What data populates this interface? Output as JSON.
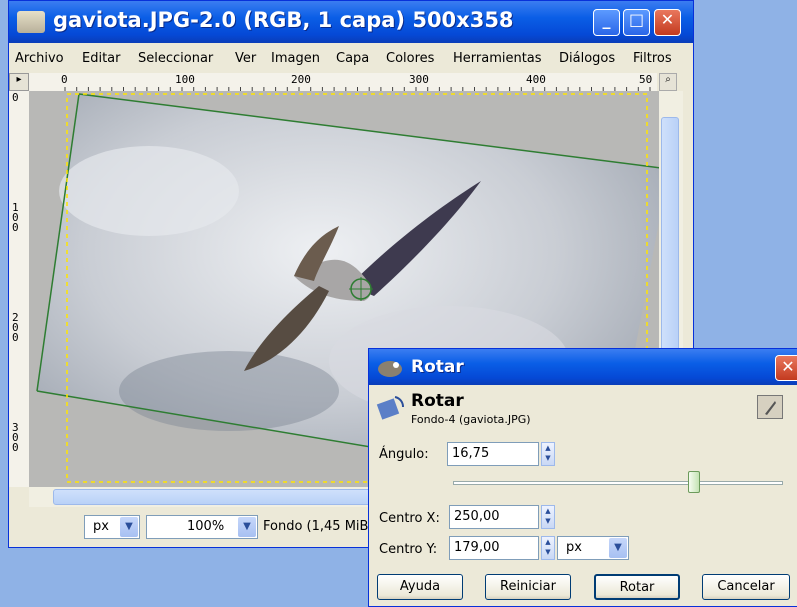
{
  "window": {
    "title": "gaviota.JPG-2.0 (RGB, 1 capa) 500x358",
    "minimize_label": "_",
    "maximize_label": "□",
    "close_label": "✕"
  },
  "menubar": {
    "items": [
      "Archivo",
      "Editar",
      "Seleccionar",
      "Ver",
      "Imagen",
      "Capa",
      "Colores",
      "Herramientas",
      "Diálogos",
      "Filtros"
    ]
  },
  "ruler": {
    "h_labels": [
      "0",
      "100",
      "200",
      "300",
      "400",
      "50"
    ],
    "v_labels": [
      "0",
      "100",
      "200",
      "300"
    ]
  },
  "statusbar": {
    "unit": "px",
    "zoom": "100%",
    "layer_info": "Fondo (1,45 MiB"
  },
  "dialog": {
    "title": "Rotar",
    "header": "Rotar",
    "subheader": "Fondo-4 (gaviota.JPG)",
    "angle_label": "Ángulo:",
    "angle_value": "16,75",
    "angle_slider_fraction": 0.73,
    "center_x_label": "Centro X:",
    "center_x_value": "250,00",
    "center_y_label": "Centro Y:",
    "center_y_value": "179,00",
    "unit": "px",
    "buttons": {
      "help": "Ayuda",
      "reset": "Reiniciar",
      "rotate": "Rotar",
      "cancel": "Cancelar"
    }
  },
  "colors": {
    "titlebar": "#0a5ee6",
    "desktop": "#8fb2e6",
    "guide_line": "#2e7d32"
  }
}
